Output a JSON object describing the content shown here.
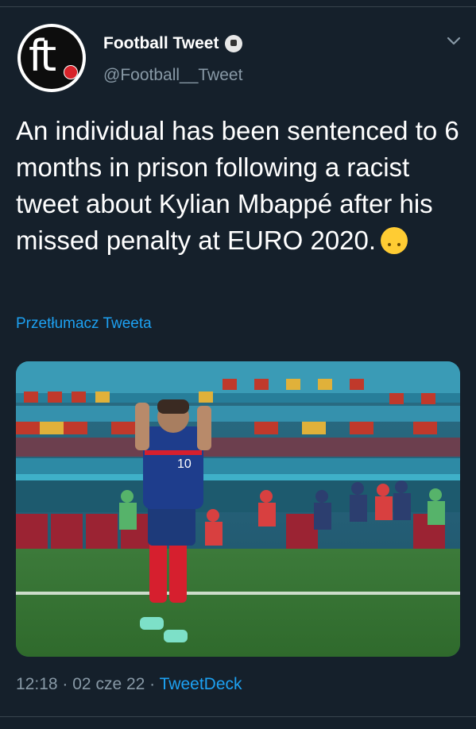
{
  "author": {
    "display_name": "Football Tweet",
    "handle": "@Football__Tweet",
    "avatar_text": "ft",
    "name_emoji": "soccer-ball-icon"
  },
  "tweet": {
    "text": "An individual has been sentenced to 6 months in prison following a racist tweet about Kylian Mbappé after his missed penalty at EURO 2020.",
    "emoji": "upside-down-face-icon",
    "translate_label": "Przetłumacz Tweeta"
  },
  "media": {
    "jersey_number": "10"
  },
  "meta": {
    "time": "12:18",
    "separator": "·",
    "date": "02 cze 22",
    "source": "TweetDeck"
  },
  "colors": {
    "background": "#15202b",
    "link": "#1da1f2",
    "secondary": "#8899a6"
  }
}
